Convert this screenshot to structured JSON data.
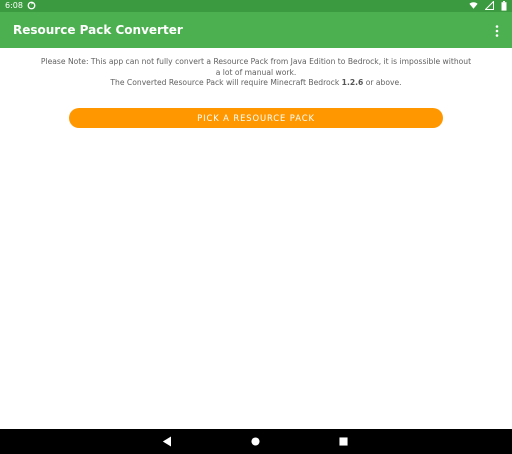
{
  "status_bar": {
    "time": "6:08",
    "icons": [
      "sync-icon",
      "wifi-icon",
      "signal-icon",
      "battery-icon"
    ]
  },
  "app_bar": {
    "title": "Resource Pack Converter",
    "menu_icon": "more-vert-icon"
  },
  "note": {
    "line1": "Please Note: This app can not fully convert a Resource Pack from Java Edition to Bedrock, it is impossible without a lot of manual work.",
    "line2_prefix": "The Converted Resource Pack will require Minecraft Bedrock ",
    "line2_version": "1.2.6",
    "line2_suffix": " or above."
  },
  "pick_button": {
    "label": "PICK A RESOURCE PACK"
  },
  "navigation": {
    "icons": [
      "back-icon",
      "home-icon",
      "recents-icon"
    ]
  },
  "colors": {
    "status_bar": "#3b9a3f",
    "app_bar": "#4caf50",
    "accent_button": "#ff9800",
    "navigation_bar": "#000000"
  }
}
